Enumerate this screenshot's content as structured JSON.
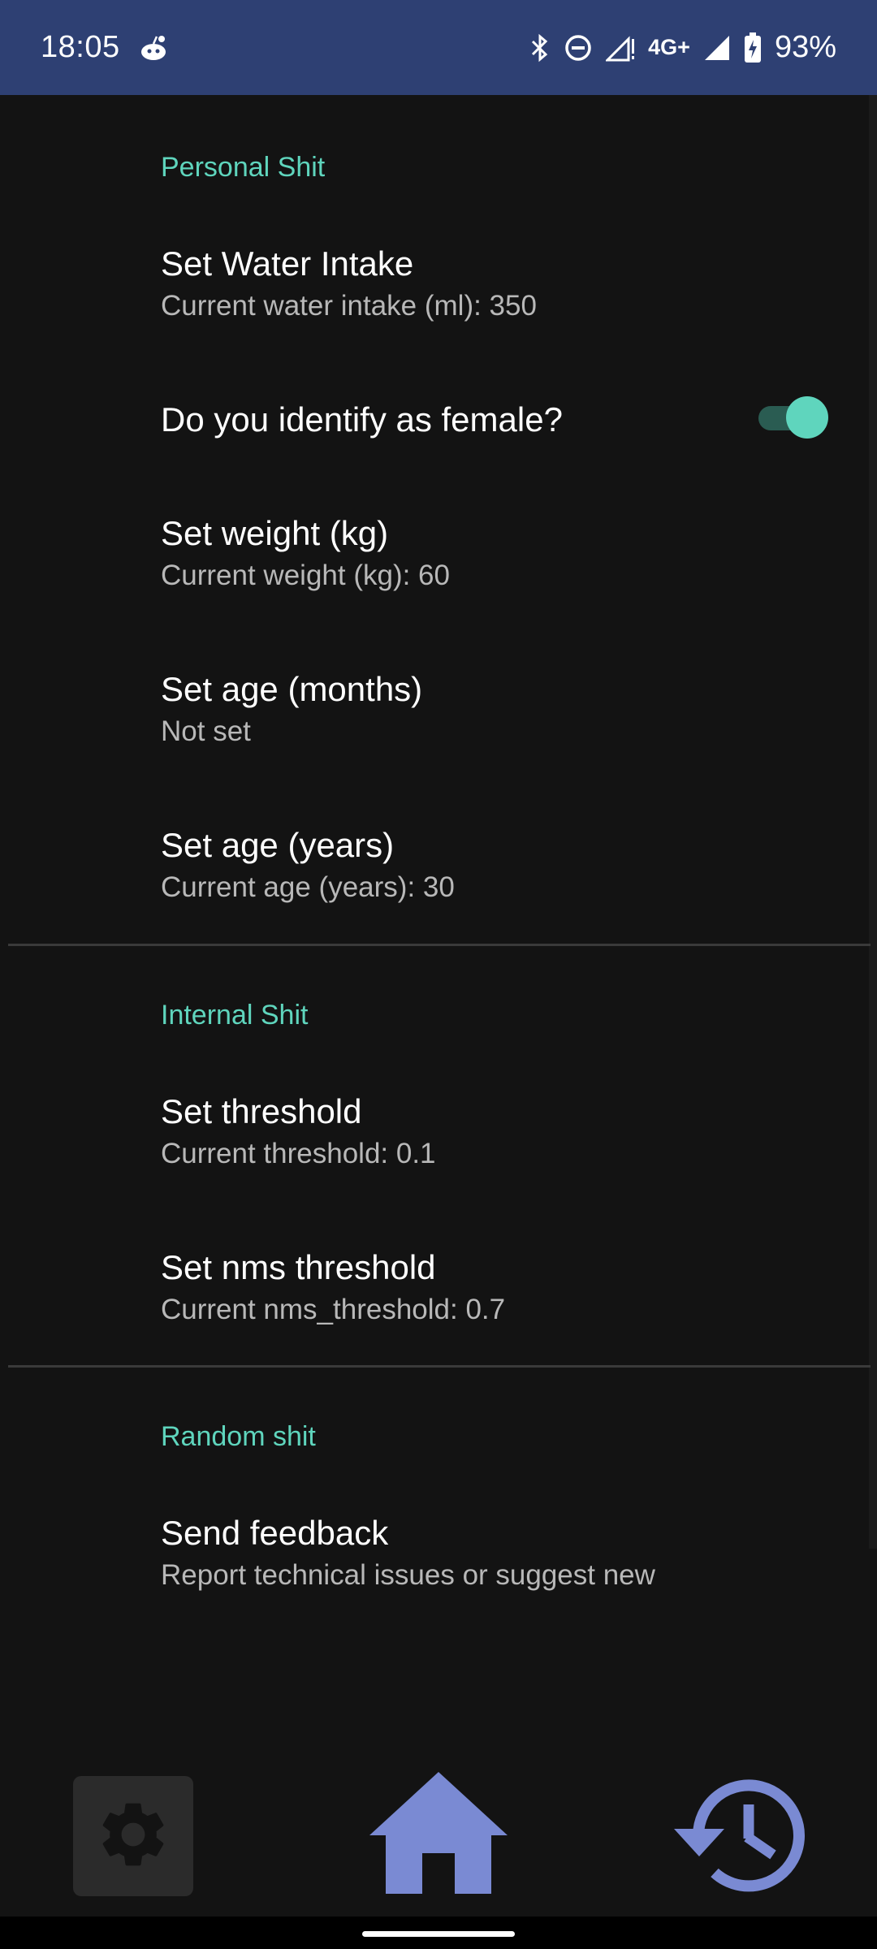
{
  "status_bar": {
    "time": "18:05",
    "network": "4G+",
    "battery": "93%"
  },
  "sections": {
    "personal": {
      "header": "Personal Shit",
      "water_title": "Set Water Intake",
      "water_summary": "Current water intake (ml): 350",
      "female_title": "Do you identify as female?",
      "female_enabled": true,
      "weight_title": "Set weight (kg)",
      "weight_summary": "Current weight (kg): 60",
      "age_months_title": "Set age (months)",
      "age_months_summary": "Not set",
      "age_years_title": "Set age (years)",
      "age_years_summary": "Current age (years): 30"
    },
    "internal": {
      "header": "Internal Shit",
      "threshold_title": "Set threshold",
      "threshold_summary": "Current threshold: 0.1",
      "nms_title": "Set nms threshold",
      "nms_summary": "Current nms_threshold: 0.7"
    },
    "random": {
      "header": "Random shit",
      "feedback_title": "Send feedback",
      "feedback_summary": "Report technical issues or suggest new"
    }
  },
  "bottom_nav": {
    "icons": [
      "gear-icon",
      "home-icon",
      "history-icon"
    ],
    "active": "settings"
  },
  "colors": {
    "accent": "#5fd5bd",
    "status_bar": "#2e4073",
    "nav_icon": "#7a8ad3",
    "background": "#131313"
  }
}
